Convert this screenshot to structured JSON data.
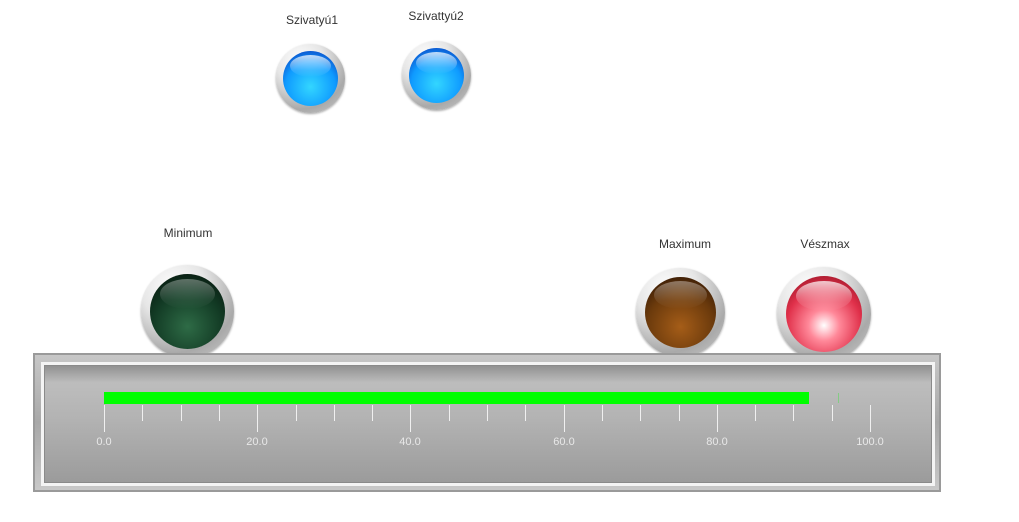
{
  "indicators": {
    "pump1": {
      "label": "Szivatyú1",
      "color": "#1aa3ff"
    },
    "pump2": {
      "label": "Szivattyú2",
      "color": "#1aa3ff"
    },
    "minimum": {
      "label": "Minimum",
      "color": "#1a3d2a"
    },
    "maximum": {
      "label": "Maximum",
      "color": "#6b3a0c"
    },
    "emergency_max": {
      "label": "Vészmax",
      "color": "#e0304a"
    }
  },
  "level_gauge": {
    "value": 92,
    "min": 0,
    "max": 100,
    "bar_color": "#00ff00",
    "tick_labels": [
      "0.0",
      "20.0",
      "40.0",
      "60.0",
      "80.0",
      "100.0"
    ]
  }
}
